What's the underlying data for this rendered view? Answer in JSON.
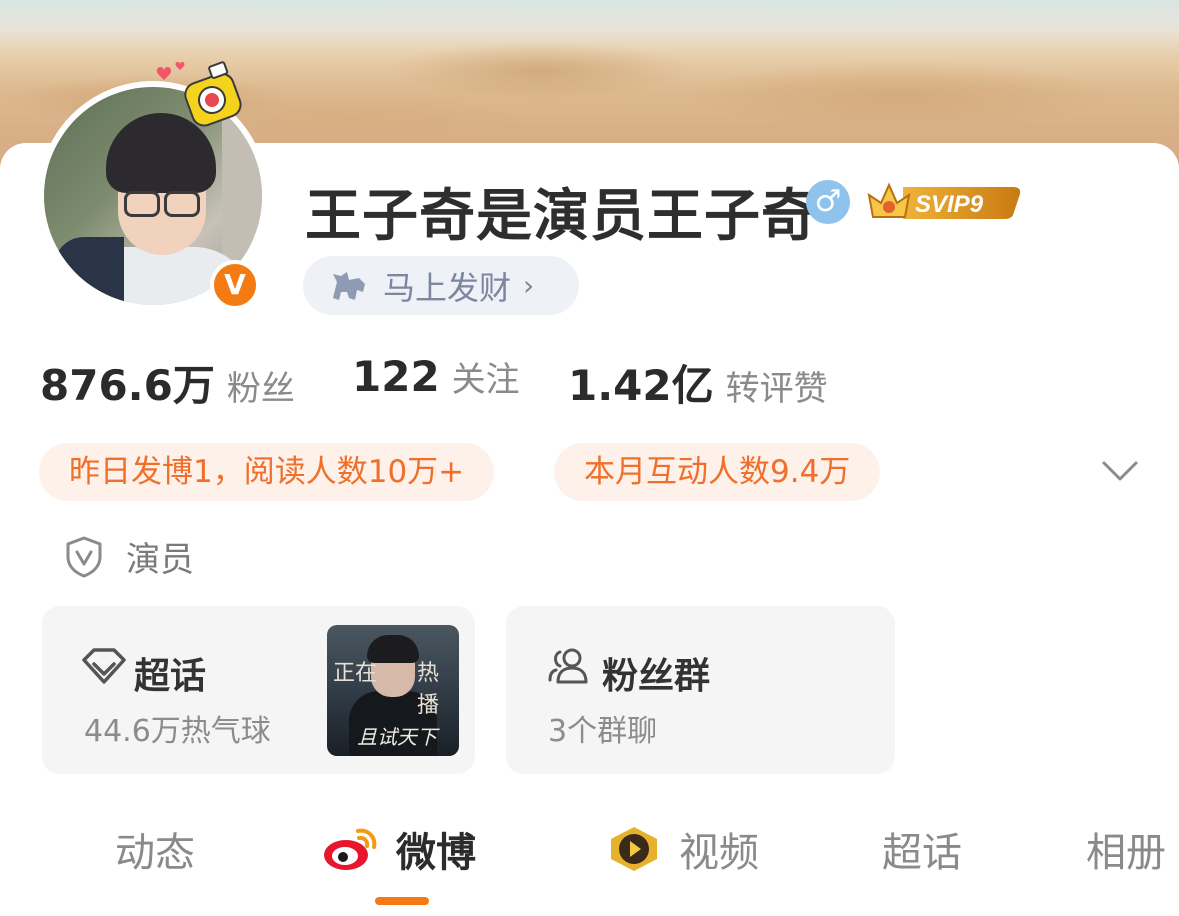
{
  "profile": {
    "name": "王子奇是演员王子奇",
    "gender_symbol": "♂",
    "vip_badge": "SVIP9",
    "verified_mark": "V",
    "fortune_pill": "马上发财",
    "fortune_chevron": "›"
  },
  "stats": [
    {
      "value": "876.6万",
      "label": "粉丝"
    },
    {
      "value": "122",
      "label": "关注"
    },
    {
      "value": "1.42亿",
      "label": "转评赞"
    }
  ],
  "highlights": [
    "昨日发博1，阅读人数10万+",
    "本月互动人数9.4万"
  ],
  "tag": {
    "label": "演员",
    "icon": "shield-v-icon"
  },
  "cards": {
    "supertopic": {
      "title": "超话",
      "subtitle": "44.6万热气球",
      "icon": "diamond-icon",
      "poster": {
        "line1": "正在",
        "line2": "热播",
        "line3": "且试天下"
      }
    },
    "fan_group": {
      "title": "粉丝群",
      "subtitle": "3个群聊",
      "icon": "group-icon"
    }
  },
  "tabs": [
    {
      "label": "动态",
      "active": false
    },
    {
      "label": "微博",
      "active": true,
      "icon": "weibo-logo-icon"
    },
    {
      "label": "视频",
      "active": false,
      "icon": "video-play-icon"
    },
    {
      "label": "超话",
      "active": false
    },
    {
      "label": "相册",
      "active": false
    }
  ],
  "colors": {
    "accent": "#f47a14",
    "highlight_text": "#ef6f2b",
    "highlight_bg": "#fdf1ea",
    "gender_bg": "#8ec3ee"
  }
}
